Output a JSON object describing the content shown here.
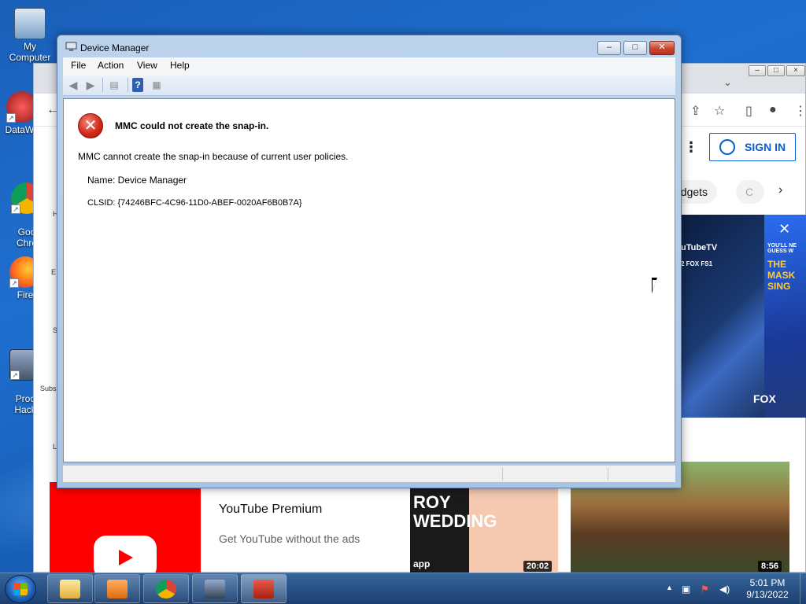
{
  "desktop": {
    "icons": [
      {
        "label": "My Computer"
      },
      {
        "label": "DataWa"
      },
      {
        "label": "Goo\nChro"
      },
      {
        "label": "Fire"
      },
      {
        "label": "Proc\nHack"
      }
    ]
  },
  "browser": {
    "sign_in_label": "SIGN IN",
    "chips": [
      "adgets",
      "C"
    ],
    "side_letters": [
      "H",
      "E",
      "S",
      "Subs",
      "L"
    ],
    "ad": {
      "line1": "uTubeTV",
      "line2": "YOU'LL NE GUESS W",
      "line3": "THE MASK SING",
      "brand": "FOX",
      "channels": "2  FOX  FS1"
    },
    "premium_title": "YouTube Premium",
    "premium_sub": "Get YouTube without the ads",
    "thumb1_text": "ROY\nWEDDING",
    "thumb1_sub": "app",
    "thumb1_duration": "20:02",
    "thumb2_duration": "8:56"
  },
  "device_manager": {
    "title": "Device Manager",
    "menu": [
      "File",
      "Action",
      "View",
      "Help"
    ],
    "error_heading": "MMC could not create the snap-in.",
    "error_message": "MMC cannot create the snap-in because of current user policies.",
    "name_line": "Name: Device Manager",
    "clsid_line": "CLSID: {74246BFC-4C96-11D0-ABEF-0020AF6B0B7A}"
  },
  "taskbar": {
    "time": "5:01 PM",
    "date": "9/13/2022"
  },
  "colors": {
    "accent": "#065fd4",
    "error_red": "#d42a1a",
    "youtube_red": "#ff0000"
  }
}
